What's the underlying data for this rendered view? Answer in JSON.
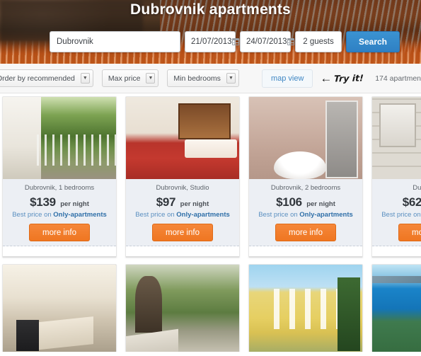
{
  "hero": {
    "title": "Dubrovnik apartments"
  },
  "search": {
    "destination_value": "Dubrovnik",
    "destination_placeholder": "Dubrovnik",
    "checkin_value": "21/07/2013",
    "checkout_value": "24/07/2013",
    "guests_value": "2 guests",
    "search_label": "Search",
    "calendar_icon": "calendar-icon"
  },
  "filters": {
    "order_by_label": "Order by recommended",
    "max_price_label": "Max price",
    "min_bedrooms_label": "Min bedrooms",
    "map_view_label": "map view",
    "caret_glyph": "▼",
    "try_it_arrow": "←",
    "try_it_text": "Try it!",
    "results_count": "174 apartmen"
  },
  "cards": {
    "per_night_label": "per night",
    "best_price_prefix": "Best price on ",
    "best_price_brand": "Only-apartments",
    "more_info_label": "more info",
    "row1": [
      {
        "location": "Dubrovnik, 1 bedrooms",
        "price": "$139",
        "photo": "balcony-terrace-photo"
      },
      {
        "location": "Dubrovnik, Studio",
        "price": "$97",
        "photo": "bedroom-photo"
      },
      {
        "location": "Dubrovnik, 2 bedrooms",
        "price": "$106",
        "photo": "bathroom-photo"
      },
      {
        "location": "Dubrovnik,",
        "price": "$62",
        "photo": "stone-wall-patio-photo"
      }
    ],
    "row2": [
      {
        "photo": "terrace-table-photo"
      },
      {
        "photo": "stone-path-arch-photo"
      },
      {
        "photo": "yellow-house-photo"
      },
      {
        "photo": "sea-view-photo"
      }
    ]
  },
  "colors": {
    "accent_orange": "#ef7621",
    "accent_blue": "#2f80c4",
    "link_blue": "#5a8fc0",
    "card_body_bg": "#eceff4"
  }
}
